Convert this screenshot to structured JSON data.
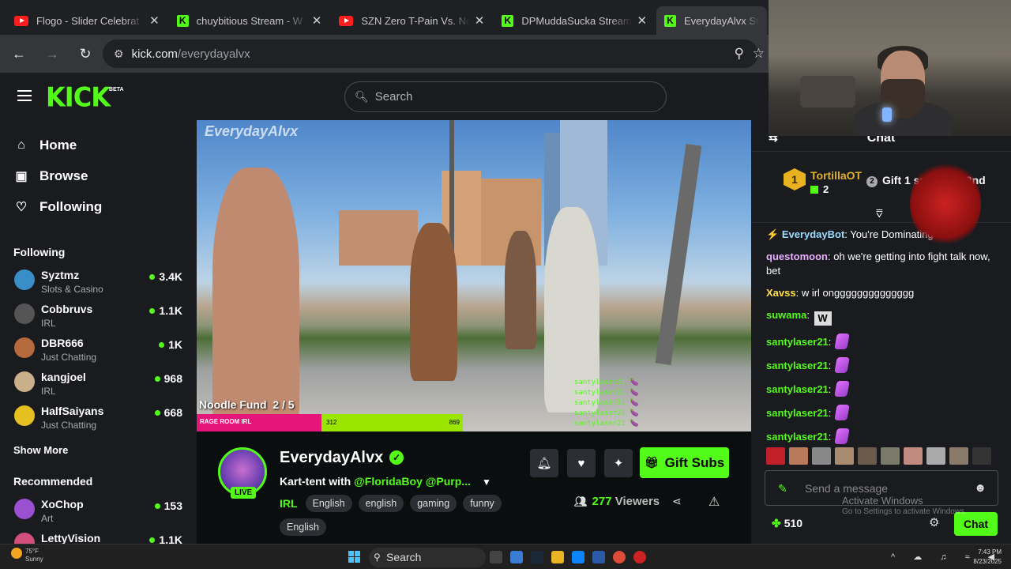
{
  "browser": {
    "tabs": [
      {
        "title": "Flogo - Slider Celebrat",
        "type": "yt"
      },
      {
        "title": "chuybitious Stream - W",
        "type": "kick"
      },
      {
        "title": "SZN Zero T-Pain Vs. No",
        "type": "yt"
      },
      {
        "title": "DPMuddaSucka Stream",
        "type": "kick"
      },
      {
        "title": "EverydayAlvx Stream",
        "type": "kick"
      }
    ],
    "url_host": "kick.com",
    "url_path": "/everydayalvx"
  },
  "header": {
    "logo": "KICK",
    "beta": "BETA",
    "search_placeholder": "Search"
  },
  "sidebar": {
    "nav": [
      {
        "label": "Home",
        "icon": "home-icon"
      },
      {
        "label": "Browse",
        "icon": "browse-icon"
      },
      {
        "label": "Following",
        "icon": "heart-icon"
      }
    ],
    "following_title": "Following",
    "following": [
      {
        "name": "Syztmz",
        "category": "Slots & Casino",
        "viewers": "3.4K",
        "color": "#3a8ec8"
      },
      {
        "name": "Cobbruvs",
        "category": "IRL",
        "viewers": "1.1K",
        "color": "#555"
      },
      {
        "name": "DBR666",
        "category": "Just Chatting",
        "viewers": "1K",
        "color": "#b46a3c"
      },
      {
        "name": "kangjoel",
        "category": "IRL",
        "viewers": "968",
        "color": "#c9b08a"
      },
      {
        "name": "HalfSaiyans",
        "category": "Just Chatting",
        "viewers": "668",
        "color": "#e6c020"
      }
    ],
    "show_more": "Show More",
    "recommended_title": "Recommended",
    "recommended": [
      {
        "name": "XoChop",
        "category": "Art",
        "viewers": "153",
        "color": "#9b4fd1"
      },
      {
        "name": "LettyVision",
        "category": "",
        "viewers": "1.1K",
        "color": "#d14f7a"
      }
    ]
  },
  "video": {
    "watermark": "EverydayAlvx",
    "noodle_label": "Noodle Fund",
    "noodle_count": "2 / 5",
    "bar_left": "RAGE ROOM IRL",
    "bar_mid": "312",
    "bar_right": "869",
    "chat_overlay": [
      "santylaser21 🍆",
      "santylaser21 🍆",
      "santylaser21 🍆",
      "santylaser21 🍆",
      "santylaser21 🍆"
    ]
  },
  "channel": {
    "name": "EverydayAlvx",
    "live": "LIVE",
    "title_prefix": "Kart-tent with ",
    "title_mentions": "@FloridaBoy @Purp...",
    "category": "IRL",
    "tags": [
      "English",
      "english",
      "gaming",
      "funny",
      "English"
    ],
    "gift_label": "Gift Subs",
    "viewers": "277",
    "viewers_label": "Viewers"
  },
  "chat": {
    "title": "Chat",
    "pinned": {
      "rank": "1",
      "name": "TortillaOT",
      "count": "2",
      "gift_text": "Gift 1 sub to be 2nd",
      "gift_num": "2"
    },
    "messages": [
      {
        "user": "EverydayBot",
        "color": "#9cdcff",
        "text": "You're Dominating",
        "badge": true
      },
      {
        "user": "questomoon",
        "color": "#e8b0ff",
        "text": "oh we're getting into fight talk now, bet"
      },
      {
        "user": "Xavss",
        "color": "#ffe14a",
        "text": "w irl ongggggggggggggg"
      },
      {
        "user": "suwama",
        "color": "#53fc18",
        "text": "",
        "emote": "W"
      },
      {
        "user": "santylaser21",
        "color": "#53fc18",
        "text": "",
        "emote": "eggplant"
      },
      {
        "user": "santylaser21",
        "color": "#53fc18",
        "text": "",
        "emote": "eggplant"
      },
      {
        "user": "santylaser21",
        "color": "#53fc18",
        "text": "",
        "emote": "eggplant"
      },
      {
        "user": "santylaser21",
        "color": "#53fc18",
        "text": "",
        "emote": "eggplant"
      },
      {
        "user": "santylaser21",
        "color": "#53fc18",
        "text": "",
        "emote": "eggplant"
      }
    ],
    "input_placeholder": "Send a message",
    "points": "510",
    "send_label": "Chat",
    "activate_title": "Activate Windows",
    "activate_sub": "Go to Settings to activate Windows."
  },
  "taskbar": {
    "weather_temp": "75°F",
    "weather_cond": "Sunny",
    "search": "Search",
    "time": "7:43 PM",
    "date": "8/23/2025"
  }
}
